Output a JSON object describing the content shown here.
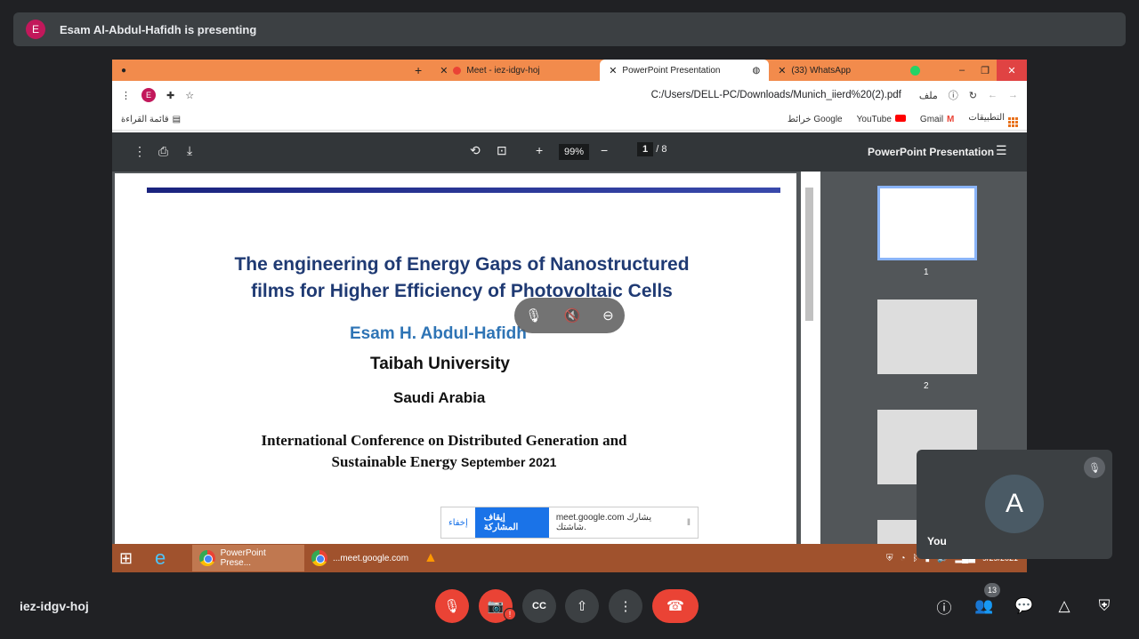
{
  "banner": {
    "avatar_letter": "E",
    "text": "Esam Al-Abdul-Hafidh is presenting"
  },
  "browser": {
    "tabs": [
      {
        "label": "Meet - iez-idgv-hoj"
      },
      {
        "label": "PowerPoint Presentation"
      },
      {
        "label": "(33) WhatsApp"
      }
    ],
    "profile_letter": "E",
    "url": "C:/Users/DELL-PC/Downloads/Munich_iierd%20(2).pdf",
    "url_prefix": "ملف",
    "bookmarks": {
      "reading_list": "قائمة القراءة",
      "maps": "خرائط Google",
      "youtube": "YouTube",
      "gmail": "Gmail",
      "apps": "التطبيقات"
    }
  },
  "pdf": {
    "zoom": "99%",
    "page_current": "1",
    "page_total": "8",
    "title": "PowerPoint Presentation",
    "slide": {
      "title_line1": "The engineering of Energy Gaps of Nanostructured",
      "title_line2": "films for Higher Efficiency of Photovoltaic Cells",
      "author": "Esam  H. Abdul-Hafidh",
      "university": "Taibah  University",
      "country": "Saudi Arabia",
      "conf_line1": "International Conference on Distributed Generation and",
      "conf_line2": "Sustainable Energy",
      "conf_date": "September 2021"
    },
    "thumbnails": [
      "1",
      "2"
    ]
  },
  "share_bar": {
    "message": "meet.google.com يشارك شاشتك.",
    "stop": "إيقاف المشاركة",
    "hide": "إخفاء"
  },
  "taskbar": {
    "task1": "PowerPoint Prese...",
    "task2": "...meet.google.com",
    "date": "9/29/2021"
  },
  "self_tile": {
    "letter": "A",
    "name": "You"
  },
  "meet": {
    "code": "iez-idgv-hoj",
    "participants": "13"
  }
}
